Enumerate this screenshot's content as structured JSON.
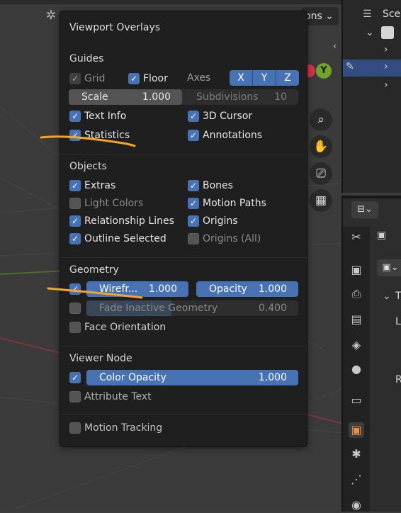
{
  "header": {
    "top_truncated": "ons"
  },
  "gizmo": {
    "y_label": "Y"
  },
  "outliner": {
    "scene_label": "Scen"
  },
  "popover": {
    "title": "Viewport Overlays",
    "guides": {
      "heading": "Guides",
      "grid": "Grid",
      "floor": "Floor",
      "axes": "Axes",
      "axis_x": "X",
      "axis_y": "Y",
      "axis_z": "Z",
      "scale_label": "Scale",
      "scale_value": "1.000",
      "subdiv_label": "Subdivisions",
      "subdiv_value": "10",
      "text_info": "Text Info",
      "cursor_3d": "3D Cursor",
      "statistics": "Statistics",
      "annotations": "Annotations"
    },
    "objects": {
      "heading": "Objects",
      "extras": "Extras",
      "bones": "Bones",
      "light_colors": "Light Colors",
      "motion_paths": "Motion Paths",
      "relationship_lines": "Relationship Lines",
      "origins": "Origins",
      "outline_selected": "Outline Selected",
      "origins_all": "Origins (All)"
    },
    "geometry": {
      "heading": "Geometry",
      "wireframe_label": "Wirefr...",
      "wireframe_value": "1.000",
      "opacity_label": "Opacity",
      "opacity_value": "1.000",
      "fade_label": "Fade Inactive Geometry",
      "fade_value": "0.400",
      "fade_fill": 0.4,
      "face_orientation": "Face Orientation"
    },
    "viewer_node": {
      "heading": "Viewer Node",
      "color_opacity_label": "Color Opacity",
      "color_opacity_value": "1.000",
      "attribute_text": "Attribute Text"
    },
    "motion_tracking": "Motion Tracking"
  },
  "properties": {
    "labels": [
      "T",
      "L",
      "R"
    ]
  },
  "colors": {
    "accent": "#4772b3",
    "annotation": "#f5a623",
    "active_tab": "#f08d3b"
  }
}
